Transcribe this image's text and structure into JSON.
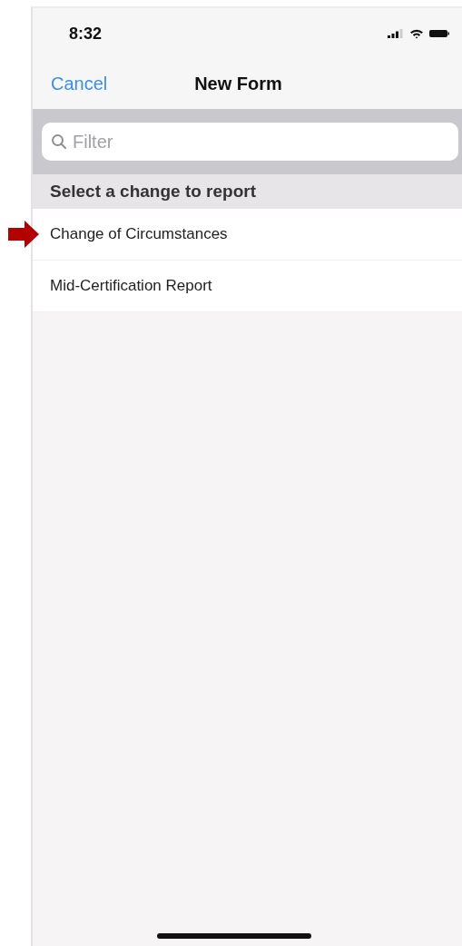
{
  "status_bar": {
    "time": "8:32"
  },
  "nav_bar": {
    "cancel": "Cancel",
    "title": "New Form"
  },
  "search": {
    "placeholder": "Filter"
  },
  "section": {
    "header": "Select a change to report"
  },
  "items": [
    {
      "label": "Change of Circumstances",
      "pointed": true
    },
    {
      "label": "Mid-Certification Report",
      "pointed": false
    }
  ]
}
